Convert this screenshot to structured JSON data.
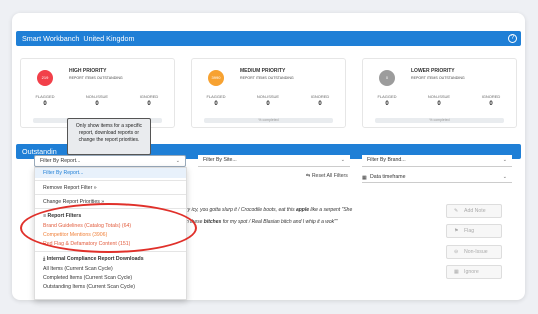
{
  "header": {
    "title": "Smart Workbanch",
    "location": "United Kingdom",
    "help_icon": "question-circle-icon"
  },
  "priorities": [
    {
      "title": "HIGH PRIORITY",
      "subtitle": "REPORT ITEMS OUTSTANDING",
      "badge": "219",
      "color": "#f2404a",
      "stats": [
        {
          "label": "FLAGGED",
          "value": "0"
        },
        {
          "label": "NON-ISSUE",
          "value": "0"
        },
        {
          "label": "IGNORED",
          "value": "0"
        }
      ],
      "progress": "% completed"
    },
    {
      "title": "MEDIUM PRIORITY",
      "subtitle": "REPORT ITEMS OUTSTANDING",
      "badge": "3990",
      "color": "#f7a231",
      "stats": [
        {
          "label": "FLAGGED",
          "value": "0"
        },
        {
          "label": "NON-ISSUE",
          "value": "0"
        },
        {
          "label": "IGNORED",
          "value": "0"
        }
      ],
      "progress": "% completed"
    },
    {
      "title": "LOWER PRIORITY",
      "subtitle": "REPORT ITEMS OUTSTANDING",
      "badge": "0",
      "color": "#9c9c9c",
      "stats": [
        {
          "label": "FLAGGED",
          "value": "0"
        },
        {
          "label": "NON-ISSUE",
          "value": "0"
        },
        {
          "label": "IGNORED",
          "value": "0"
        }
      ],
      "progress": "% completed"
    }
  ],
  "outstanding": {
    "title": "Outstandin"
  },
  "tooltip": {
    "line1": "Only show items for a specific",
    "line2": "report, download reports or",
    "line3": "change the report priorities."
  },
  "filters": {
    "report": "Filter By Report...",
    "site": "Filter By Site...",
    "brand": "Filter By Brand...",
    "reset": "Reset All Filters",
    "date": "Data timeframe"
  },
  "menu": {
    "selected": "Filter By Report...",
    "remove": "Remove Report Filter »",
    "change": "Change Report Priorities »",
    "report_filters_header": "Report Filters",
    "report_filters": [
      "Brand Guidelines (Catalog Totals) (64)",
      "Competitor Mentions (3906)",
      "Red Flag & Defamatory Content (151)"
    ],
    "downloads_header": "Internal Compliance Report Downloads",
    "downloads": [
      "All Items (Current Scan Cycle)",
      "Completed Items (Current Scan Cycle)",
      "Outstanding Items (Current Scan Cycle)"
    ]
  },
  "content": {
    "line1_a": "ry icy, you gotta slurp it / Crocodile boots, eat this ",
    "line1_b": "apple",
    "line1_c": " like a serpent \"She",
    "line2_a": "n these ",
    "line2_b": "bitches",
    "line2_c": " for my spot / Real Blasian bitch and I whip it a wok\"\""
  },
  "actions": [
    {
      "label": "Add Note",
      "icon": "edit-icon"
    },
    {
      "label": "Flag",
      "icon": "flag-icon"
    },
    {
      "label": "Non-Issue",
      "icon": "minus-circle-icon"
    },
    {
      "label": "Ignore",
      "icon": "ignore-icon"
    }
  ]
}
